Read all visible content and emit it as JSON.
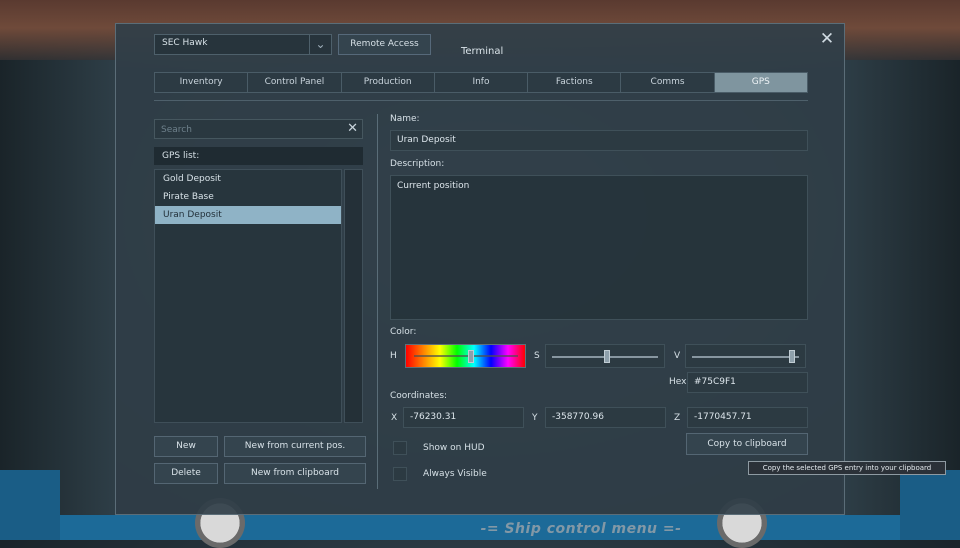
{
  "window": {
    "grid_selected": "SEC Hawk",
    "remote_access_label": "Remote Access",
    "title": "Terminal"
  },
  "tabs": [
    {
      "label": "Inventory"
    },
    {
      "label": "Control Panel"
    },
    {
      "label": "Production"
    },
    {
      "label": "Info"
    },
    {
      "label": "Factions"
    },
    {
      "label": "Comms"
    },
    {
      "label": "GPS",
      "active": true
    }
  ],
  "search": {
    "placeholder": "Search"
  },
  "gps_list": {
    "label": "GPS list:",
    "items": [
      "Gold Deposit",
      "Pirate Base",
      "Uran Deposit"
    ],
    "selected": "Uran Deposit"
  },
  "buttons": {
    "new": "New",
    "new_from_current": "New from current pos.",
    "delete": "Delete",
    "new_from_clipboard": "New from clipboard",
    "copy_to_clipboard": "Copy to clipboard"
  },
  "details": {
    "name_label": "Name:",
    "name_value": "Uran Deposit",
    "description_label": "Description:",
    "description_value": "Current position",
    "color_label": "Color:",
    "h_label": "H",
    "s_label": "S",
    "v_label": "V",
    "hue": 0.55,
    "saturation": 0.52,
    "value": 0.93,
    "hex_label": "Hex",
    "hex_value": "#75C9F1",
    "coordinates_label": "Coordinates:",
    "x_label": "X",
    "x_value": "-76230.31",
    "y_label": "Y",
    "y_value": "-358770.96",
    "z_label": "Z",
    "z_value": "-1770457.71",
    "show_on_hud_label": "Show on  HUD",
    "always_visible_label": "Always Visible"
  },
  "tooltip": "Copy the selected GPS entry into your clipboard",
  "footer": "-= Ship control menu =-",
  "colors": {
    "selection": "#8fb3c6",
    "active_tab": "#7f959f",
    "gps_color": "#75C9F1"
  }
}
